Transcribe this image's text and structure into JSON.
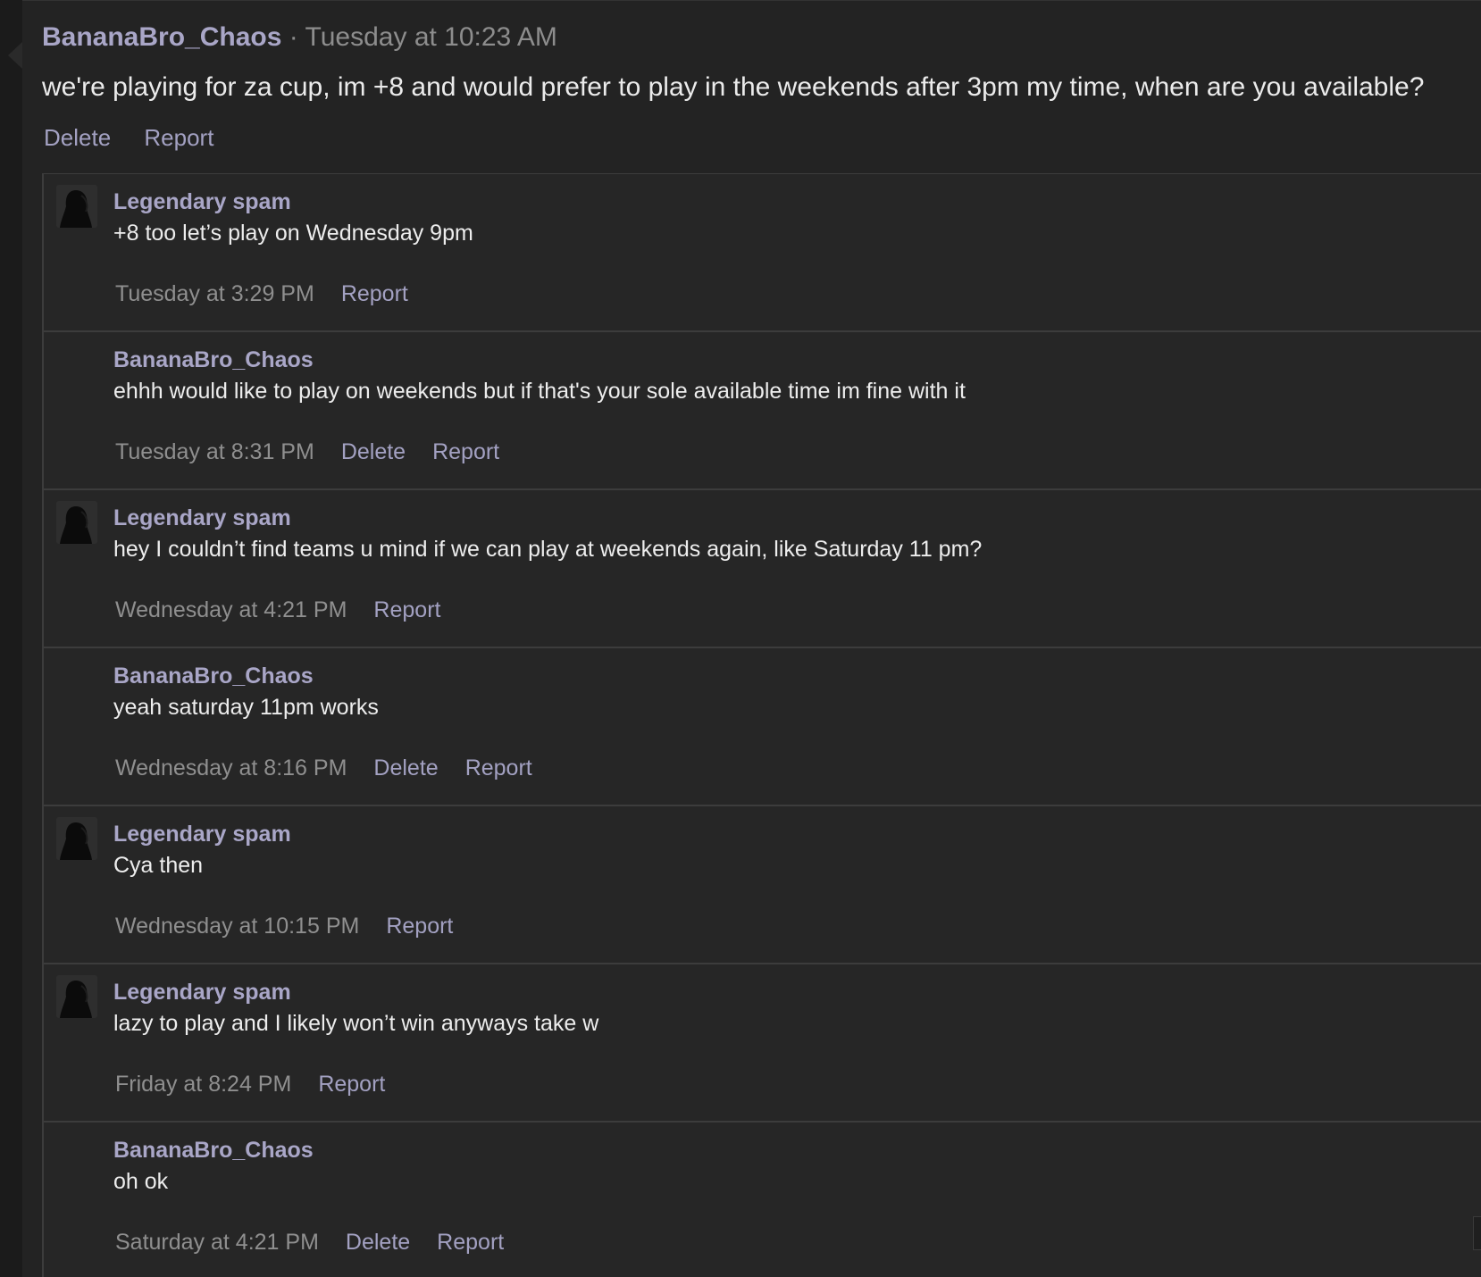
{
  "post": {
    "author": "BananaBro_Chaos",
    "separator": " · ",
    "time": "Tuesday at 10:23 AM",
    "text": "we're playing for za cup, im +8 and would prefer to play in the weekends after 3pm my time, when are you available?",
    "actions": {
      "delete": "Delete",
      "report": "Report"
    }
  },
  "replies": [
    {
      "author": "Legendary spam",
      "text": "+8 too let’s play on Wednesday 9pm",
      "time": "Tuesday at 3:29 PM",
      "delete": "",
      "report": "Report",
      "has_avatar": true
    },
    {
      "author": "BananaBro_Chaos",
      "text": "ehhh would like to play on weekends but if that's your sole available time im fine with it",
      "time": "Tuesday at 8:31 PM",
      "delete": "Delete",
      "report": "Report",
      "has_avatar": false
    },
    {
      "author": "Legendary spam",
      "text": "hey I couldn’t find teams u mind if we can play at weekends again, like Saturday 11 pm?",
      "time": "Wednesday at 4:21 PM",
      "delete": "",
      "report": "Report",
      "has_avatar": true
    },
    {
      "author": "BananaBro_Chaos",
      "text": "yeah saturday 11pm works",
      "time": "Wednesday at 8:16 PM",
      "delete": "Delete",
      "report": "Report",
      "has_avatar": false
    },
    {
      "author": "Legendary spam",
      "text": "Cya then",
      "time": "Wednesday at 10:15 PM",
      "delete": "",
      "report": "Report",
      "has_avatar": true
    },
    {
      "author": "Legendary spam",
      "text": "lazy to play and I likely won’t win anyways take w",
      "time": "Friday at 8:24 PM",
      "delete": "",
      "report": "Report",
      "has_avatar": true
    },
    {
      "author": "BananaBro_Chaos",
      "text": "oh ok",
      "time": "Saturday at 4:21 PM",
      "delete": "Delete",
      "report": "Report",
      "has_avatar": false
    }
  ]
}
